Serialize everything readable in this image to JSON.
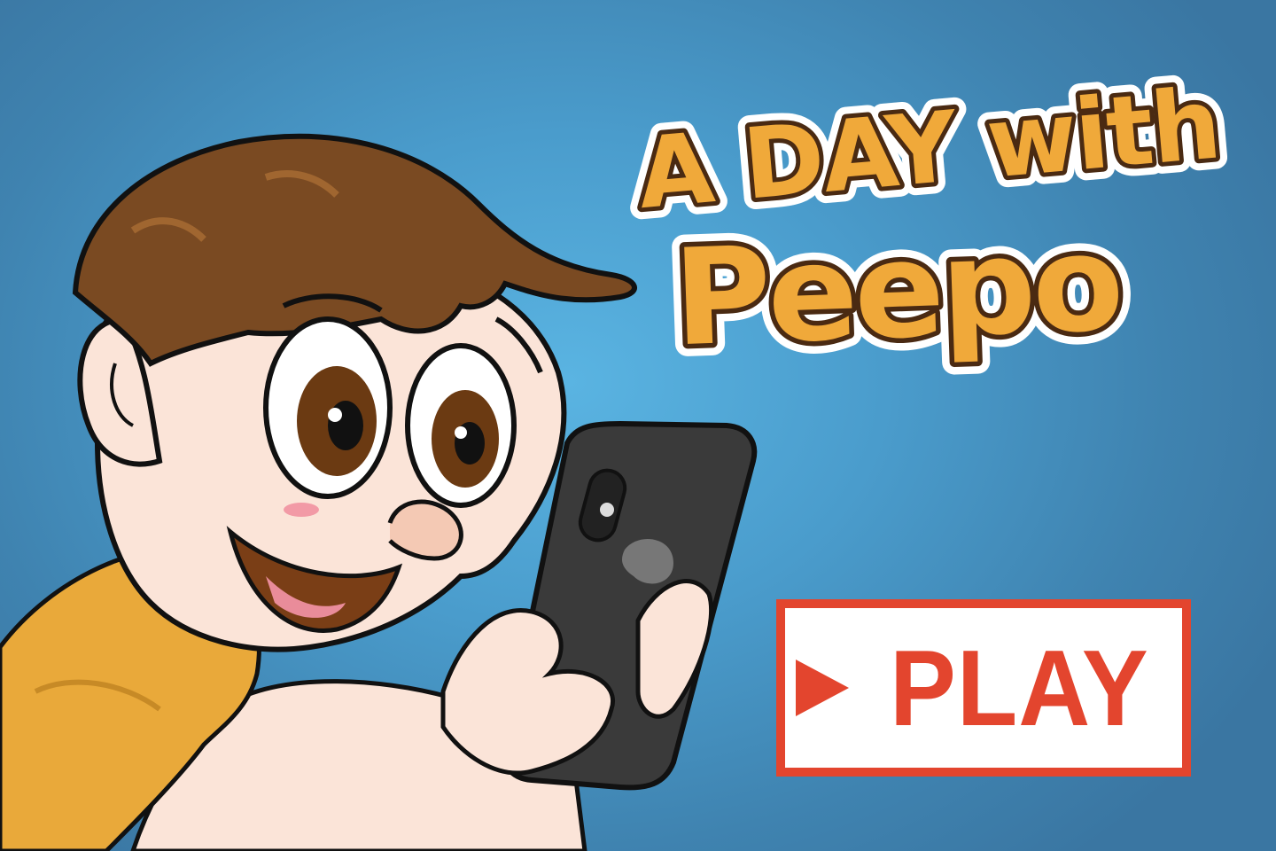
{
  "title": {
    "line1": "A DAY with",
    "line2": "Peepo"
  },
  "play_button": {
    "label": "PLAY"
  },
  "icons": {
    "play": "play-triangle-icon"
  },
  "colors": {
    "background": "#4a9ccc",
    "title_fill": "#f0a93a",
    "title_stroke_inner": "#4a2a12",
    "title_stroke_outer": "#ffffff",
    "play_accent": "#e3452e",
    "shirt": "#e9a93a",
    "hair": "#7a4a22",
    "skin": "#fbe4d8",
    "phone": "#3a3a3a"
  }
}
